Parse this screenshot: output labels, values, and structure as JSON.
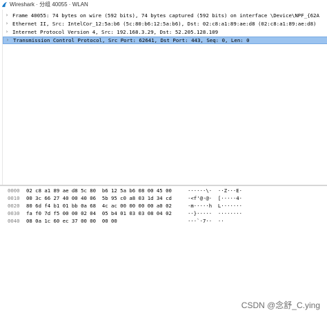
{
  "window": {
    "title": "Wireshark · 分组 40055 · WLAN"
  },
  "details": [
    {
      "text": "Frame 40055: 74 bytes on wire (592 bits), 74 bytes captured (592 bits) on interface \\Device\\NPF_{62A",
      "selected": false
    },
    {
      "text": "Ethernet II, Src: IntelCor_12:5a:b6 (5c:80:b6:12:5a:b6), Dst: 02:c8:a1:89:ae:d8 (02:c8:a1:89:ae:d8)",
      "selected": false
    },
    {
      "text": "Internet Protocol Version 4, Src: 192.168.3.29, Dst: 52.205.128.109",
      "selected": false
    },
    {
      "text": "Transmission Control Protocol, Src Port: 62641, Dst Port: 443, Seq: 0, Len: 0",
      "selected": true
    }
  ],
  "bytes": [
    {
      "offset": "0000",
      "hex": "02 c8 a1 89 ae d8 5c 80  b6 12 5a b6 08 00 45 00",
      "ascii": "······\\·  ··Z···E·"
    },
    {
      "offset": "0010",
      "hex": "00 3c 66 27 40 00 40 06  5b 95 c0 a8 03 1d 34 cd",
      "ascii": "·<f'@·@·  [·····4·"
    },
    {
      "offset": "0020",
      "hex": "80 6d f4 b1 01 bb 0a 68  4c ac 00 00 00 00 a0 02",
      "ascii": "·m·····h  L·······"
    },
    {
      "offset": "0030",
      "hex": "fa f0 7d f5 00 00 02 04  05 b4 01 03 03 08 04 02",
      "ascii": "··}·····  ········"
    },
    {
      "offset": "0040",
      "hex": "08 0a 1c 60 ec 37 00 00  00 00",
      "ascii": "···`·7··  ··"
    }
  ],
  "watermark": "CSDN @念舒_C.ying",
  "colors": {
    "selected_row": "#9bc3ef",
    "offset_text": "#7f7f7f"
  }
}
